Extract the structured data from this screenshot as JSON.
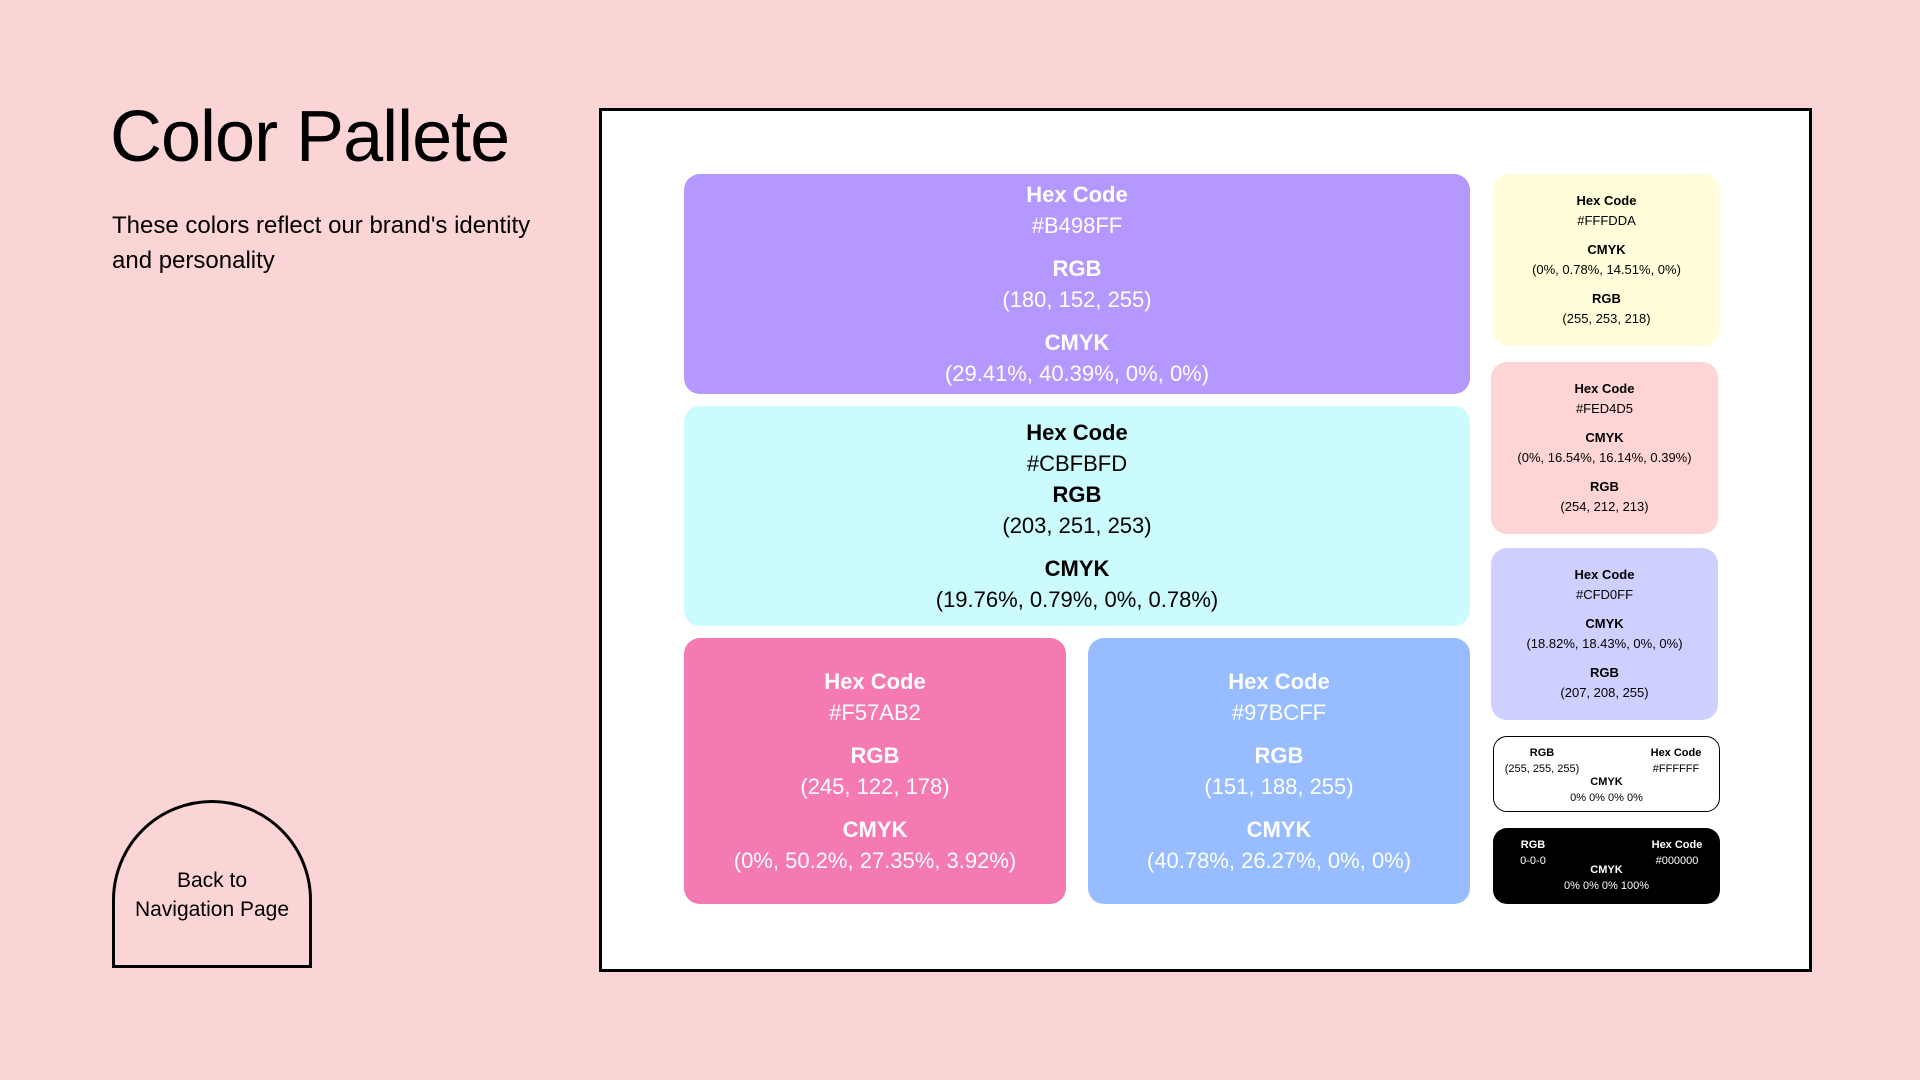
{
  "page": {
    "title": "Color Pallete",
    "subtitle": "These colors reflect our brand's identity and personality",
    "back_button": "Back to Navigation Page"
  },
  "labels": {
    "hex": "Hex Code",
    "rgb": "RGB",
    "cmyk": "CMYK"
  },
  "swatches": {
    "purple": {
      "hex": "#B498FF",
      "rgb": "(180, 152, 255)",
      "cmyk": "(29.41%, 40.39%, 0%, 0%)",
      "color": "#B498FF"
    },
    "cyan": {
      "hex": "#CBFBFD",
      "rgb": "(203, 251, 253)",
      "cmyk": "(19.76%, 0.79%, 0%, 0.78%)",
      "color": "#CBFBFD"
    },
    "pink": {
      "hex": "#F57AB2",
      "rgb": "(245, 122, 178)",
      "cmyk": "(0%, 50.2%, 27.35%, 3.92%)",
      "color": "#F57AB2"
    },
    "blue": {
      "hex": "#97BCFF",
      "rgb": "(151, 188, 255)",
      "cmyk": "(40.78%, 26.27%, 0%, 0%)",
      "color": "#97BCFF"
    },
    "yellow": {
      "hex": "#FFFDDA",
      "rgb": "(255, 253, 218)",
      "cmyk": "(0%, 0.78%, 14.51%, 0%)",
      "color": "#FFFDDA"
    },
    "rose": {
      "hex": "#FED4D5",
      "rgb": "(254, 212, 213)",
      "cmyk": "(0%, 16.54%, 16.14%, 0.39%)",
      "color": "#FED4D5"
    },
    "lavender": {
      "hex": "#CFD0FF",
      "rgb": "(207, 208, 255)",
      "cmyk": "(18.82%, 18.43%, 0%, 0%)",
      "color": "#CFD0FF"
    },
    "white": {
      "hex": "#FFFFFF",
      "rgb": "(255, 255, 255)",
      "cmyk": "0% 0% 0% 0%",
      "color": "#FFFFFF"
    },
    "black": {
      "hex": "#000000",
      "rgb": "0-0-0",
      "cmyk": "0% 0% 0% 100%",
      "color": "#000000"
    }
  }
}
